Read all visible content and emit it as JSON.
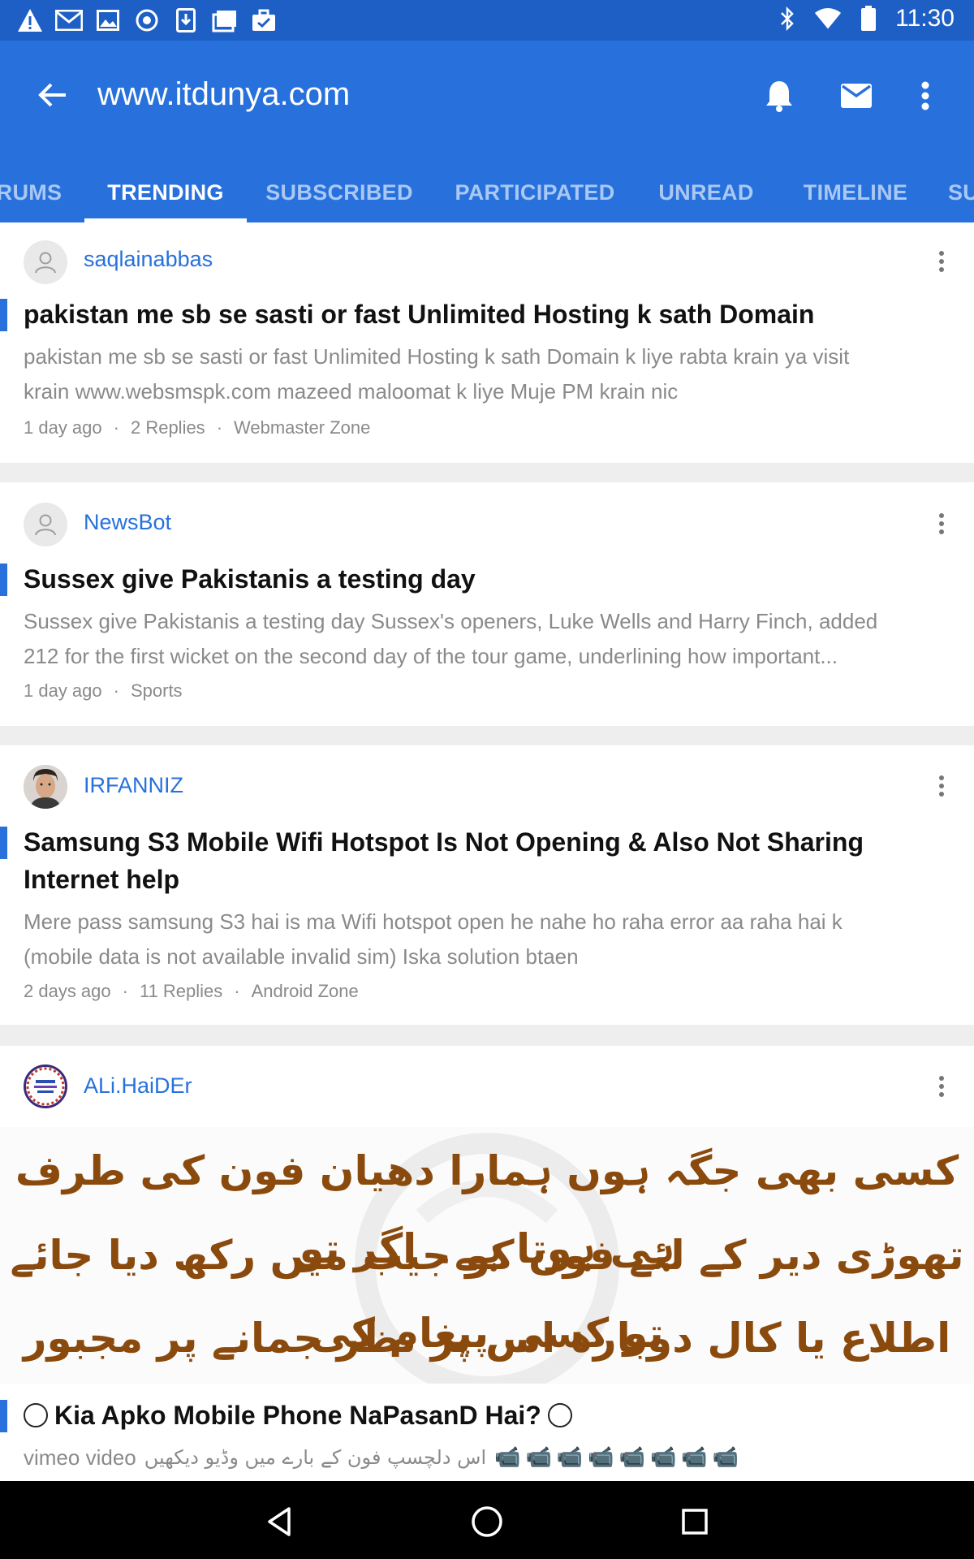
{
  "status_bar": {
    "time": "11:30",
    "left_icons": [
      "warning-icon",
      "gmail-icon",
      "image-icon",
      "vpn-icon",
      "download-icon",
      "photo-stack-icon",
      "briefcase-icon"
    ],
    "right_icons": [
      "bluetooth-icon",
      "wifi-icon",
      "battery-icon"
    ]
  },
  "app_bar": {
    "title": "www.itdunya.com",
    "color": "#2871dc",
    "actions": [
      "bell-icon",
      "mail-icon",
      "overflow-menu-icon"
    ]
  },
  "tabs": [
    {
      "label": "RUMS",
      "active": false
    },
    {
      "label": "TRENDING",
      "active": true
    },
    {
      "label": "SUBSCRIBED",
      "active": false
    },
    {
      "label": "PARTICIPATED",
      "active": false
    },
    {
      "label": "UNREAD",
      "active": false
    },
    {
      "label": "TIMELINE",
      "active": false
    },
    {
      "label": "SU",
      "active": false
    }
  ],
  "posts": [
    {
      "username": "saqlainabbas",
      "title": "pakistan me sb se sasti or fast Unlimited Hosting k sath Domain",
      "body_line1": "pakistan me sb se sasti or fast Unlimited Hosting k sath Domain k liye rabta krain ya visit",
      "body_line2": "krain www.websmspk.com mazeed maloomat k liye Muje PM krain nic",
      "time": "1 day ago",
      "replies": "2 Replies",
      "forum": "Webmaster Zone"
    },
    {
      "username": "NewsBot",
      "title": "Sussex give Pakistanis a testing day",
      "body_line1": "Sussex give Pakistanis a testing day Sussex's openers, Luke Wells and Harry Finch, added",
      "body_line2": "212 for the first wicket on the second day of the tour game, underlining how important...",
      "time": "1 day ago",
      "forum": "Sports"
    },
    {
      "username": "IRFANNIZ",
      "title_line1": "Samsung S3 Mobile Wifi Hotspot Is Not Opening & Also Not Sharing",
      "title_line2": "Internet help",
      "body_line1": "Mere pass samsung S3 hai is ma Wifi hotspot open he nahe ho raha error aa raha hai k",
      "body_line2": "(mobile data is not available invalid sim) Iska solution btaen",
      "time": "2 days ago",
      "replies": "11 Replies",
      "forum": "Android Zone"
    },
    {
      "username": "ALi.HaiDEr",
      "image_lines": [
        "کسی بھی جگہ ہوں ہمارا دھیان فون کی طرف ہی ہوتا ہے۔ اگر تو",
        "تھوڑی دیر کے لئے فون کو جیب میں رکھ دیا جائے تو کسی پیغام کی",
        "اطلاع یا کال دوبارہ اس پر نظر جمانے پر مجبور کر دیتی ہے۔"
      ],
      "title": "Kia Apko Mobile Phone NaPasanD Hai?",
      "body_prefix": "vimeo video",
      "body_urdu": "اس دلچسپ فون کے بارے میں وڈیو دیکھیں",
      "body_emoji": "📹📹📹📹📹📹📹📹"
    }
  ],
  "nav_bar": [
    "back-triangle-icon",
    "home-circle-icon",
    "recents-square-icon"
  ]
}
